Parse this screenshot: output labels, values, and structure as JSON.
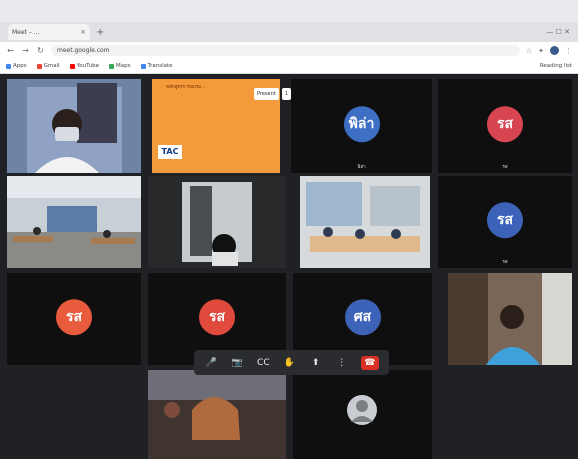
{
  "browser": {
    "tab_title": "Meet – ...",
    "url": "meet.google.com",
    "bookmarks": [
      "Apps",
      "Gmail",
      "YouTube",
      "Maps",
      "Translate"
    ],
    "reading_list": "Reading list"
  },
  "presenting_bar": {
    "label": "Present",
    "count": "1",
    "button": "ON"
  },
  "slide": {
    "text": "หลักสูตรการอบรม ...",
    "logo": "TAC"
  },
  "tiles": [
    {
      "initials": "พิล่า",
      "name": "พิล่า",
      "color": "#3d6fc4"
    },
    {
      "initials": "รส",
      "name": "รส",
      "color": "#d64550"
    },
    {
      "initials": "รส",
      "name": "รส",
      "color": "#3d63b8"
    },
    {
      "initials": "รส",
      "name": "รส",
      "color": "#e85b3c"
    },
    {
      "initials": "รส",
      "name": "รส",
      "color": "#e04a3d"
    },
    {
      "initials": "ศส",
      "name": "ศส",
      "color": "#3d63b8"
    }
  ],
  "toolbar_icons": [
    "mic-icon",
    "camera-icon",
    "captions-icon",
    "hand-icon",
    "present-icon",
    "more-icon",
    "leave-call-icon"
  ],
  "toolbar_glyphs": [
    "🎤",
    "📷",
    "CC",
    "✋",
    "⬆",
    "⋮",
    "☎"
  ]
}
